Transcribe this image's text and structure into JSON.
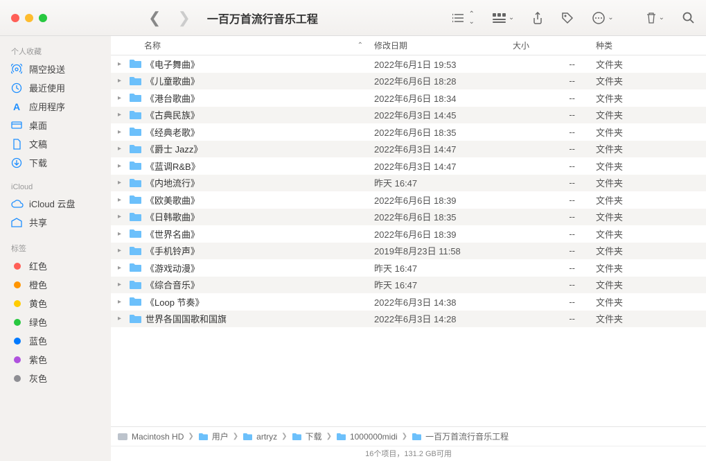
{
  "window": {
    "title": "一百万首流行音乐工程"
  },
  "sidebar": {
    "sections": [
      {
        "header": "个人收藏",
        "items": [
          {
            "icon": "airdrop",
            "label": "隔空投送"
          },
          {
            "icon": "clock",
            "label": "最近使用"
          },
          {
            "icon": "apps",
            "label": "应用程序"
          },
          {
            "icon": "desktop",
            "label": "桌面"
          },
          {
            "icon": "doc",
            "label": "文稿"
          },
          {
            "icon": "download",
            "label": "下载"
          }
        ]
      },
      {
        "header": "iCloud",
        "items": [
          {
            "icon": "cloud",
            "label": "iCloud 云盘"
          },
          {
            "icon": "shared",
            "label": "共享"
          }
        ]
      },
      {
        "header": "标签",
        "items": [
          {
            "icon": "tag",
            "color": "#ff5f57",
            "label": "红色"
          },
          {
            "icon": "tag",
            "color": "#ff9500",
            "label": "橙色"
          },
          {
            "icon": "tag",
            "color": "#ffcc00",
            "label": "黄色"
          },
          {
            "icon": "tag",
            "color": "#28c840",
            "label": "绿色"
          },
          {
            "icon": "tag",
            "color": "#007aff",
            "label": "蓝色"
          },
          {
            "icon": "tag",
            "color": "#af52de",
            "label": "紫色"
          },
          {
            "icon": "tag",
            "color": "#8e8e93",
            "label": "灰色"
          }
        ]
      }
    ]
  },
  "columns": {
    "name": "名称",
    "date": "修改日期",
    "size": "大小",
    "kind": "种类"
  },
  "files": [
    {
      "name": "《电子舞曲》",
      "date": "2022年6月1日 19:53",
      "size": "--",
      "kind": "文件夹"
    },
    {
      "name": "《儿童歌曲》",
      "date": "2022年6月6日 18:28",
      "size": "--",
      "kind": "文件夹"
    },
    {
      "name": "《港台歌曲》",
      "date": "2022年6月6日 18:34",
      "size": "--",
      "kind": "文件夹"
    },
    {
      "name": "《古典民族》",
      "date": "2022年6月3日 14:45",
      "size": "--",
      "kind": "文件夹"
    },
    {
      "name": "《经典老歌》",
      "date": "2022年6月6日 18:35",
      "size": "--",
      "kind": "文件夹"
    },
    {
      "name": "《爵士 Jazz》",
      "date": "2022年6月3日 14:47",
      "size": "--",
      "kind": "文件夹"
    },
    {
      "name": "《蓝调R&B》",
      "date": "2022年6月3日 14:47",
      "size": "--",
      "kind": "文件夹"
    },
    {
      "name": "《内地流行》",
      "date": "昨天 16:47",
      "size": "--",
      "kind": "文件夹"
    },
    {
      "name": "《欧美歌曲》",
      "date": "2022年6月6日 18:39",
      "size": "--",
      "kind": "文件夹"
    },
    {
      "name": "《日韩歌曲》",
      "date": "2022年6月6日 18:35",
      "size": "--",
      "kind": "文件夹"
    },
    {
      "name": "《世界名曲》",
      "date": "2022年6月6日 18:39",
      "size": "--",
      "kind": "文件夹"
    },
    {
      "name": "《手机铃声》",
      "date": "2019年8月23日 11:58",
      "size": "--",
      "kind": "文件夹"
    },
    {
      "name": "《游戏动漫》",
      "date": "昨天 16:47",
      "size": "--",
      "kind": "文件夹"
    },
    {
      "name": "《综合音乐》",
      "date": "昨天 16:47",
      "size": "--",
      "kind": "文件夹"
    },
    {
      "name": "《Loop 节奏》",
      "date": "2022年6月3日 14:38",
      "size": "--",
      "kind": "文件夹"
    },
    {
      "name": "世界各国国歌和国旗",
      "date": "2022年6月3日 14:28",
      "size": "--",
      "kind": "文件夹"
    }
  ],
  "path": [
    {
      "icon": "disk",
      "label": "Macintosh HD"
    },
    {
      "icon": "folder",
      "label": "用户"
    },
    {
      "icon": "folder",
      "label": "artryz"
    },
    {
      "icon": "folder",
      "label": "下载"
    },
    {
      "icon": "folder",
      "label": "1000000midi"
    },
    {
      "icon": "folder",
      "label": "一百万首流行音乐工程"
    }
  ],
  "status": "16个项目，131.2 GB可用"
}
